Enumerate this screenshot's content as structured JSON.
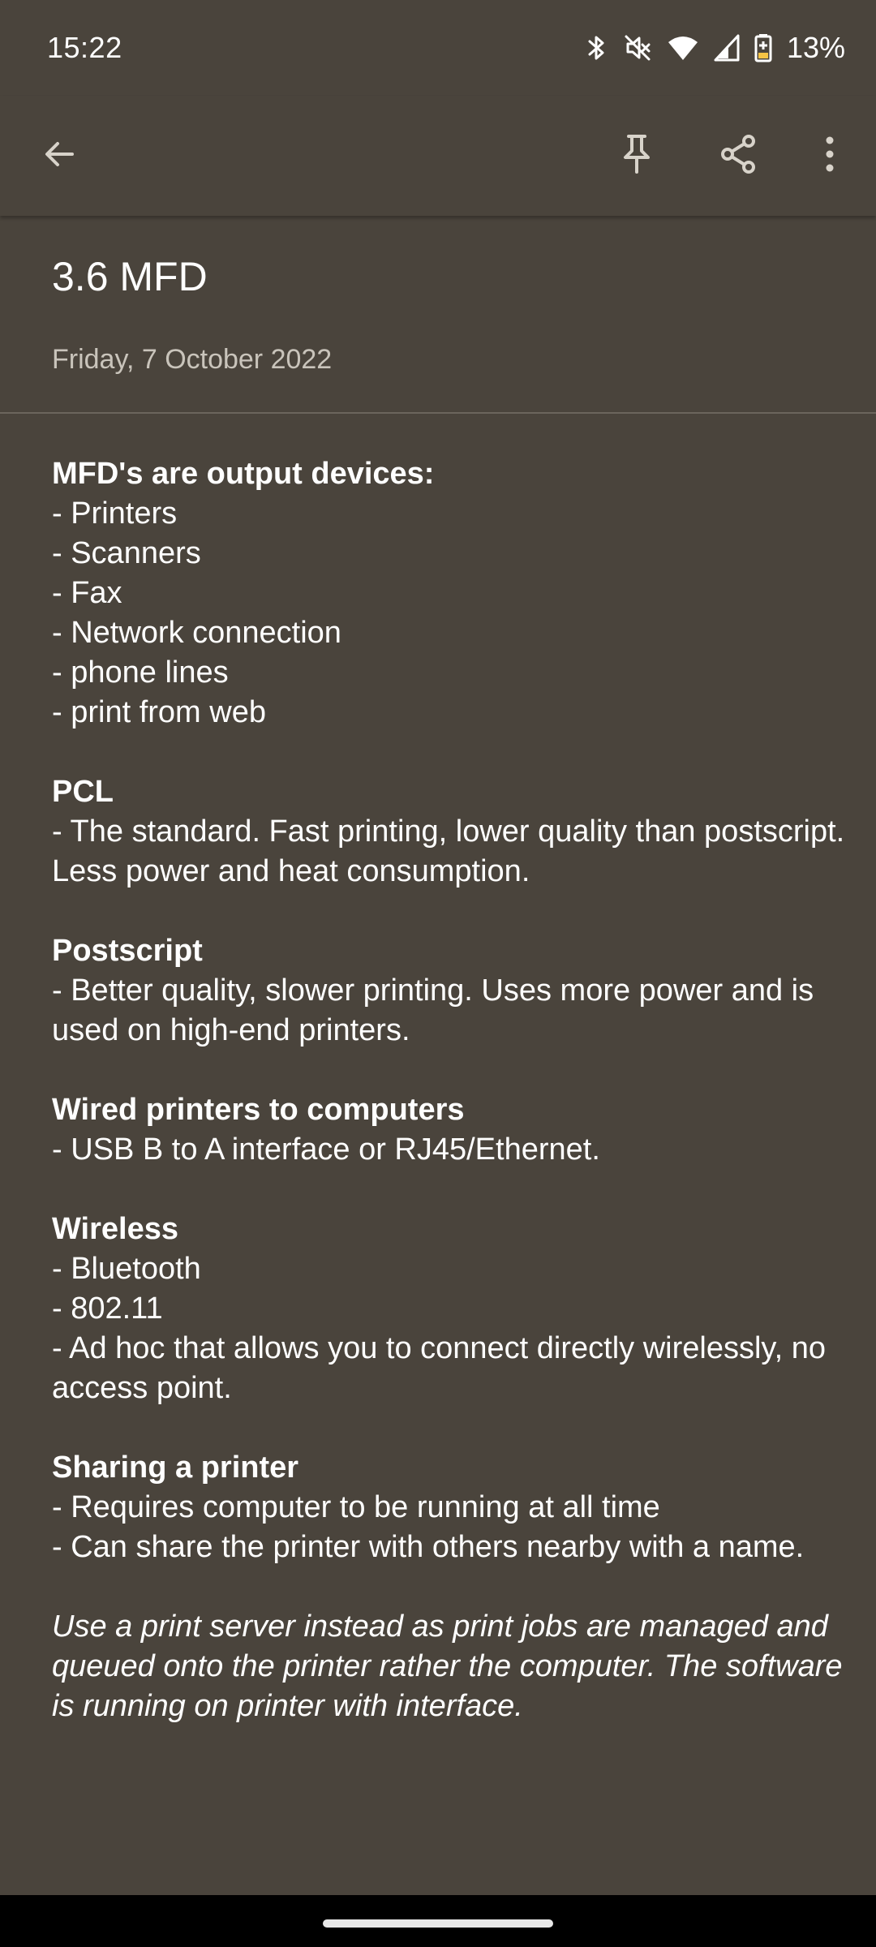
{
  "status_bar": {
    "time": "15:22",
    "battery": "13%",
    "icons": [
      "bluetooth-icon",
      "mute-icon",
      "wifi-icon",
      "signal-icon",
      "battery-icon"
    ]
  },
  "toolbar": {
    "back_icon": "arrow-left-icon",
    "pin_icon": "pin-icon",
    "share_icon": "share-icon",
    "more_icon": "more-vertical-icon"
  },
  "note": {
    "title": "3.6 MFD",
    "date": "Friday, 7 October 2022",
    "lines": [
      {
        "text": "MFD's are output devices:",
        "style": "bold"
      },
      {
        "text": "- Printers",
        "style": "normal"
      },
      {
        "text": "- Scanners",
        "style": "normal"
      },
      {
        "text": "- Fax",
        "style": "normal"
      },
      {
        "text": "- Network connection",
        "style": "normal"
      },
      {
        "text": "- phone lines",
        "style": "normal"
      },
      {
        "text": "- print from web",
        "style": "normal"
      },
      {
        "text": "",
        "style": "gap"
      },
      {
        "text": "PCL",
        "style": "bold"
      },
      {
        "text": "- The standard. Fast printing, lower quality than postscript. Less power and heat consumption.",
        "style": "normal"
      },
      {
        "text": "",
        "style": "gap"
      },
      {
        "text": "Postscript",
        "style": "bold"
      },
      {
        "text": "- Better quality, slower printing. Uses more power and is used on high-end printers.",
        "style": "normal"
      },
      {
        "text": "",
        "style": "gap"
      },
      {
        "text": "Wired printers to computers",
        "style": "bold"
      },
      {
        "text": "- USB B to A interface or RJ45/Ethernet.",
        "style": "normal"
      },
      {
        "text": "",
        "style": "gap"
      },
      {
        "text": "Wireless",
        "style": "bold"
      },
      {
        "text": "- Bluetooth",
        "style": "normal"
      },
      {
        "text": "- 802.11",
        "style": "normal"
      },
      {
        "text": "- Ad hoc that allows you to connect directly wirelessly, no access point.",
        "style": "normal"
      },
      {
        "text": "",
        "style": "gap"
      },
      {
        "text": "Sharing a printer",
        "style": "bold"
      },
      {
        "text": "- Requires computer to be running at all time",
        "style": "normal"
      },
      {
        "text": "- Can share the printer with others nearby with a name.",
        "style": "normal"
      },
      {
        "text": "",
        "style": "gap"
      },
      {
        "text": "Use a print server instead as print jobs are managed and queued onto the printer rather the computer. The software is running on printer with interface.",
        "style": "italic"
      }
    ]
  },
  "colors": {
    "background": "#4a443c",
    "text": "#ffffff",
    "date_text": "#c9c4bb",
    "divider": "#6b655c"
  }
}
